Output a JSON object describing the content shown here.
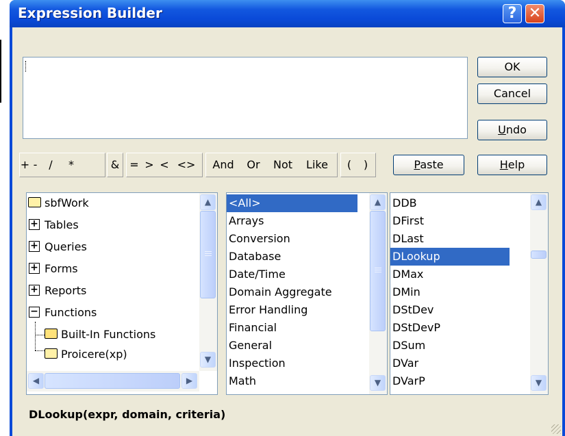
{
  "window": {
    "title": "Expression Builder",
    "help_glyph": "?",
    "close_glyph": "✕"
  },
  "buttons": {
    "ok": "OK",
    "cancel": "Cancel",
    "undo": "Undo",
    "paste": "Paste",
    "help": "Help"
  },
  "operators": {
    "arith": [
      "+",
      "-",
      "/",
      "*"
    ],
    "amp": "&",
    "compare": [
      "=",
      ">",
      "<",
      "<>"
    ],
    "logic": [
      "And",
      "Or",
      "Not",
      "Like"
    ],
    "paren": [
      "(",
      ")"
    ]
  },
  "expression": {
    "value": ""
  },
  "tree": {
    "items": [
      {
        "label": "sbfWork",
        "expander": ""
      },
      {
        "label": "Tables",
        "expander": "+"
      },
      {
        "label": "Queries",
        "expander": "+"
      },
      {
        "label": "Forms",
        "expander": "+"
      },
      {
        "label": "Reports",
        "expander": "+"
      },
      {
        "label": "Functions",
        "expander": "−"
      },
      {
        "label": "Built-In Functions",
        "expander": "",
        "selected": true
      },
      {
        "label": "Proicere(xp)",
        "expander": ""
      }
    ]
  },
  "categories": {
    "items": [
      "<All>",
      "Arrays",
      "Conversion",
      "Database",
      "Date/Time",
      "Domain Aggregate",
      "Error Handling",
      "Financial",
      "General",
      "Inspection",
      "Math"
    ],
    "selected": "<All>"
  },
  "functions": {
    "items": [
      "DDB",
      "DFirst",
      "DLast",
      "DLookup",
      "DMax",
      "DMin",
      "DStDev",
      "DStDevP",
      "DSum",
      "DVar",
      "DVarP"
    ],
    "selected": "DLookup"
  },
  "status": {
    "signature": "DLookup(expr, domain, criteria)"
  },
  "colors": {
    "titlebar": "#0a4ad8",
    "selection": "#316ac5",
    "dialog_bg": "#ece9d8"
  },
  "icons": {
    "help": "question-icon",
    "close": "close-icon",
    "folder": "folder-icon",
    "expand": "plus-icon",
    "collapse": "minus-icon"
  }
}
